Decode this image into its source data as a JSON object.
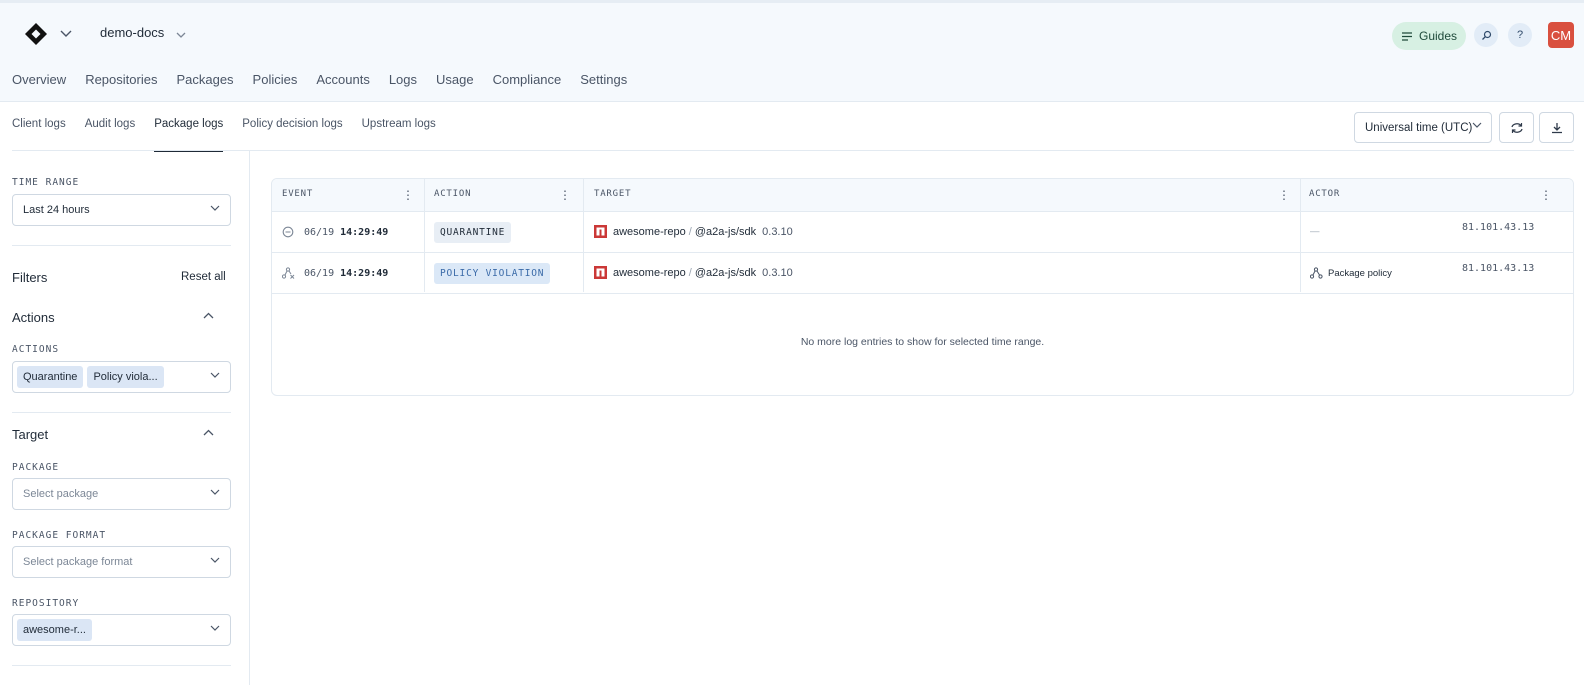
{
  "header": {
    "workspace": "demo-docs",
    "nav": [
      "Overview",
      "Repositories",
      "Packages",
      "Policies",
      "Accounts",
      "Logs",
      "Usage",
      "Compliance",
      "Settings"
    ],
    "guides_label": "Guides",
    "help_label": "?",
    "avatar_initials": "CM"
  },
  "subtabs": {
    "items": [
      "Client logs",
      "Audit logs",
      "Package logs",
      "Policy decision logs",
      "Upstream logs"
    ],
    "active": "Package logs",
    "timezone": "Universal time (UTC)"
  },
  "sidebar": {
    "time_range_label": "TIME RANGE",
    "time_range_value": "Last 24 hours",
    "filters_title": "Filters",
    "reset_all": "Reset all",
    "actions_title": "Actions",
    "actions_label": "ACTIONS",
    "actions_chips": [
      "Quarantine",
      "Policy viola..."
    ],
    "target_title": "Target",
    "package_label": "PACKAGE",
    "package_placeholder": "Select package",
    "format_label": "PACKAGE FORMAT",
    "format_placeholder": "Select package format",
    "repository_label": "REPOSITORY",
    "repository_chip": "awesome-r..."
  },
  "table": {
    "columns": [
      "EVENT",
      "ACTION",
      "TARGET",
      "ACTOR"
    ],
    "rows": [
      {
        "date": "06/19",
        "time": "14:29:49",
        "action": "QUARANTINE",
        "repo": "awesome-repo",
        "package": "@a2a-js/sdk",
        "version": "0.3.10",
        "actor": "—",
        "ip": "81.101.43.13"
      },
      {
        "date": "06/19",
        "time": "14:29:49",
        "action": "POLICY VIOLATION",
        "repo": "awesome-repo",
        "package": "@a2a-js/sdk",
        "version": "0.3.10",
        "actor": "Package policy",
        "ip": "81.101.43.13"
      }
    ],
    "empty_message": "No more log entries to show for selected time range."
  },
  "colors": {
    "header_bg": "#f5f9fd",
    "guides_bg": "#d7f0e3",
    "avatar_bg": "#d9503f",
    "npm_red": "#cb3837",
    "policy_badge_text": "#3a6aa8"
  }
}
